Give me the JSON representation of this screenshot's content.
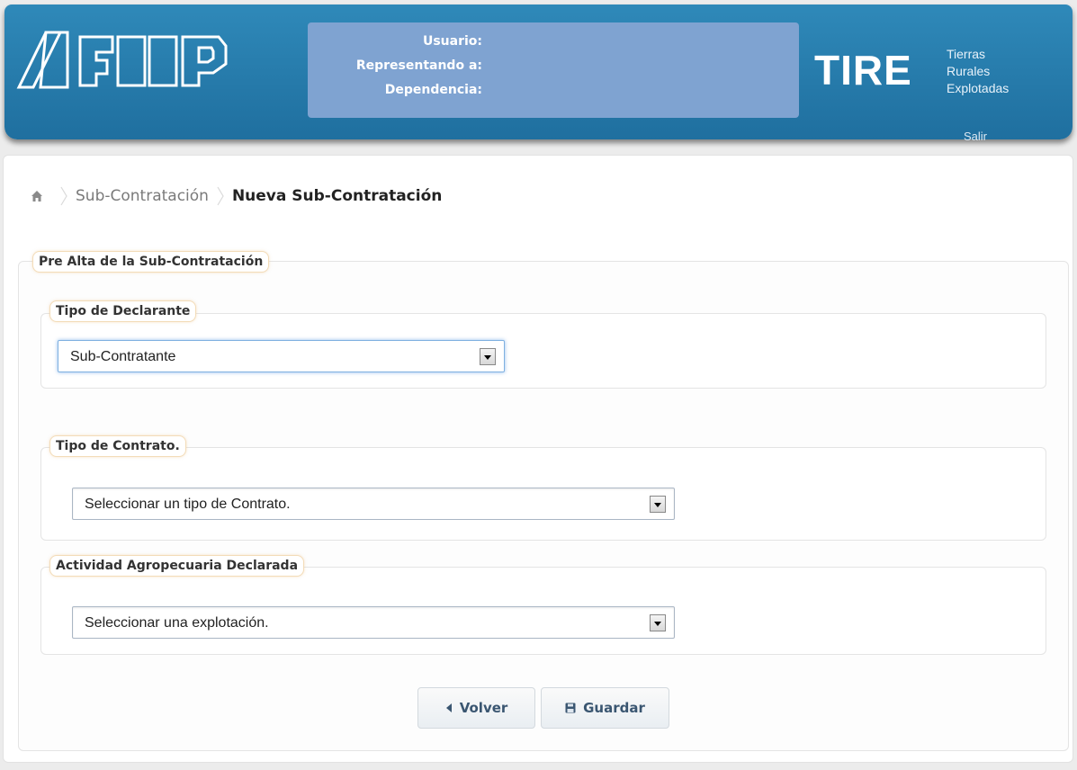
{
  "header": {
    "logo_text": "AFIP",
    "user_rows": [
      "Usuario:",
      "Representando a:",
      "Dependencia:"
    ],
    "app_name": "TIRE",
    "app_subtitle": [
      "Tierras",
      "Rurales",
      "Explotadas"
    ],
    "logout_label": "Salir"
  },
  "breadcrumb": {
    "home_icon": "home-icon",
    "parent": "Sub-Contratación",
    "current": "Nueva Sub-Contratación"
  },
  "form": {
    "legend": "Pre Alta de la Sub-Contratación",
    "declarant": {
      "legend": "Tipo de Declarante",
      "selected": "Sub-Contratante"
    },
    "contract": {
      "legend": "Tipo de Contrato.",
      "selected": "Seleccionar un tipo de Contrato."
    },
    "activity": {
      "legend": "Actividad Agropecuaria Declarada",
      "selected": "Seleccionar una explotación."
    },
    "buttons": {
      "back": "Volver",
      "save": "Guardar"
    }
  },
  "colors": {
    "header_blue": "#2679ab",
    "user_box": "#7fa3d1",
    "legend_border": "#f3dcb8",
    "button_text": "#3a5671"
  }
}
